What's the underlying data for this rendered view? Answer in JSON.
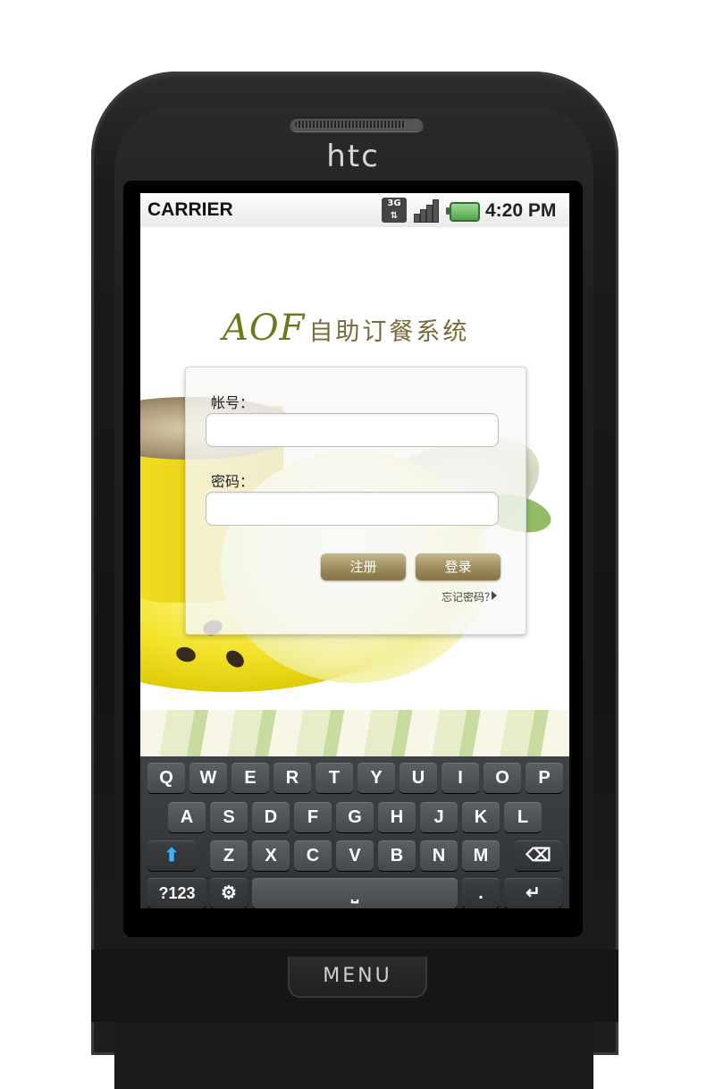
{
  "device": {
    "brand": "htc",
    "menu_label": "MENU"
  },
  "statusbar": {
    "carrier": "CARRIER",
    "network_icon": "3g-icon",
    "network_label": "3G",
    "signal_icon": "signal-icon",
    "battery_icon": "battery-icon",
    "time": "4:20 PM"
  },
  "app": {
    "title_latin": "AOF",
    "title_cn": "自助订餐系统",
    "account_label": "帐号：",
    "account_value": "",
    "password_label": "密码：",
    "password_value": "",
    "register_label": "注册",
    "login_label": "登录",
    "forgot_label": "忘记密码？"
  },
  "keyboard": {
    "row1": [
      "Q",
      "W",
      "E",
      "R",
      "T",
      "Y",
      "U",
      "I",
      "O",
      "P"
    ],
    "row2": [
      "A",
      "S",
      "D",
      "F",
      "G",
      "H",
      "J",
      "K",
      "L"
    ],
    "row3": [
      "Z",
      "X",
      "C",
      "V",
      "B",
      "N",
      "M"
    ],
    "shift_icon": "shift-icon",
    "backspace_icon": "backspace-icon",
    "symbols_label": "?123",
    "settings_icon": "gear-icon",
    "space_icon": "space-icon",
    "period_label": ".",
    "enter_icon": "enter-icon"
  },
  "colors": {
    "button": "#a08f61",
    "title_green": "#6a7a1a",
    "keyboard": "#3d4245"
  }
}
